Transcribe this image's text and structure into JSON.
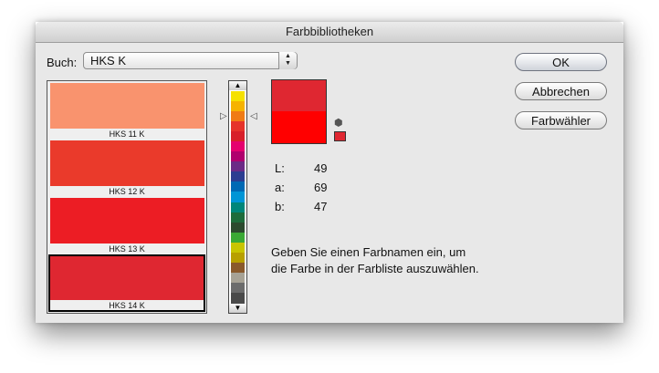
{
  "window": {
    "title": "Farbbibliotheken"
  },
  "book": {
    "label": "Buch:",
    "selected": "HKS K",
    "stepper": "▲▼"
  },
  "buttons": {
    "ok": "OK",
    "cancel": "Abbrechen",
    "picker": "Farbwähler"
  },
  "swatches": [
    {
      "name": "HKS 11 K",
      "color": "#f9936e"
    },
    {
      "name": "HKS 12 K",
      "color": "#ea3a2b"
    },
    {
      "name": "HKS 13 K",
      "color": "#ec1d24"
    },
    {
      "name": "HKS 14 K",
      "color": "#df2731",
      "selected": true
    }
  ],
  "spectrum": {
    "up_arrow": "▲",
    "down_arrow": "▼",
    "markers": {
      "left": "▷",
      "right": "◁"
    },
    "colors": [
      "#f5e100",
      "#f6b300",
      "#f07b14",
      "#e6332a",
      "#d81f2a",
      "#e5006e",
      "#b0006e",
      "#6c2a86",
      "#2c3d91",
      "#0069b4",
      "#0095d6",
      "#00867a",
      "#1e6c3b",
      "#2c4a2e",
      "#3aa935",
      "#c8c500",
      "#b8a000",
      "#8a5a2b",
      "#a7a295",
      "#6c6c6c",
      "#4a4a4a"
    ]
  },
  "preview": {
    "new_color": "#df2731",
    "old_color": "#ff0000",
    "gamut_color": "#df2731",
    "cube_icon": "⬢"
  },
  "lab": {
    "L": {
      "label": "L:",
      "value": "49"
    },
    "a": {
      "label": "a:",
      "value": "69"
    },
    "b": {
      "label": "b:",
      "value": "47"
    }
  },
  "message": {
    "line1": "Geben Sie einen Farbnamen ein, um",
    "line2": "die Farbe in der Farbliste auszuwählen."
  }
}
